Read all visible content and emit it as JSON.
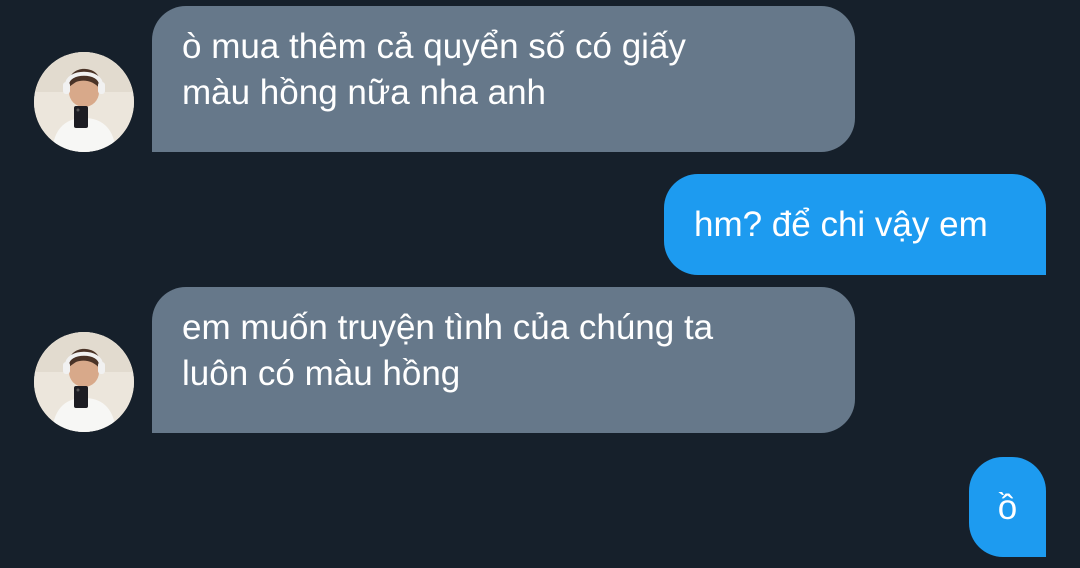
{
  "conversation": {
    "messages": [
      {
        "direction": "incoming",
        "lines": [
          "ò mua thêm cả quyển số có giấy",
          "màu hồng nữa nha anh"
        ]
      },
      {
        "direction": "outgoing",
        "lines": [
          "hm? để chi vậy em"
        ]
      },
      {
        "direction": "incoming",
        "lines": [
          "em muốn truyện tình của chúng ta",
          "luôn có màu hồng"
        ]
      },
      {
        "direction": "outgoing",
        "lines": [
          "ồ"
        ]
      }
    ]
  },
  "colors": {
    "background": "#16202b",
    "incoming_bubble": "#66788a",
    "outgoing_bubble": "#1d9bf0",
    "text": "#ffffff"
  }
}
